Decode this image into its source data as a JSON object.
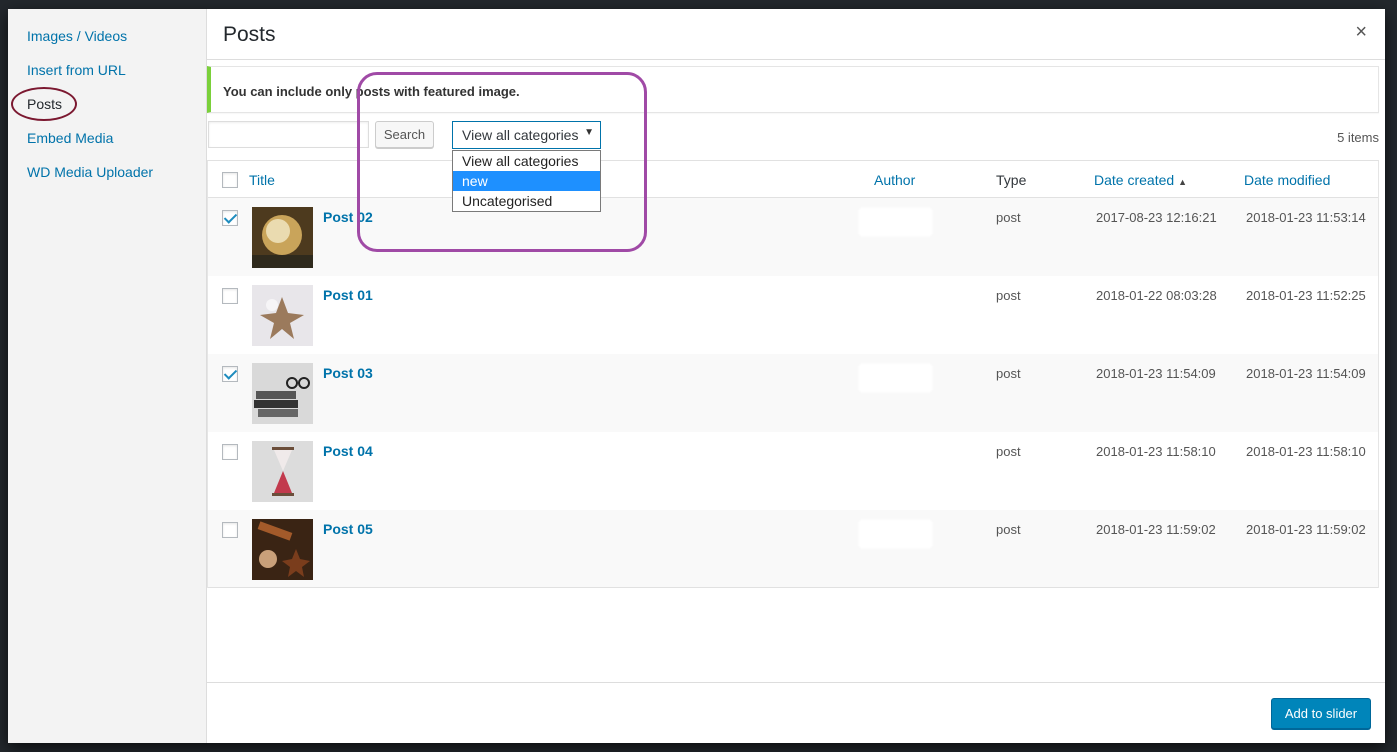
{
  "sidebar": {
    "items": [
      {
        "label": "Images / Videos"
      },
      {
        "label": "Insert from URL"
      },
      {
        "label": "Posts"
      },
      {
        "label": "Embed Media"
      },
      {
        "label": "WD Media Uploader"
      }
    ]
  },
  "header": {
    "title": "Posts",
    "close": "×"
  },
  "notice": {
    "text": "You can include only posts with featured image."
  },
  "toolbar": {
    "search_placeholder": "",
    "search_label": "Search",
    "category_selected": "View all categories",
    "category_options": [
      "View all categories",
      "new",
      "Uncategorised"
    ],
    "highlighted_option": "new",
    "items_count": "5 items"
  },
  "table": {
    "headers": {
      "title": "Title",
      "author": "Author",
      "type": "Type",
      "date_created": "Date created",
      "date_modified": "Date modified"
    },
    "sort_indicator": "▲",
    "rows": [
      {
        "title": "Post 02",
        "checked": true,
        "type": "post",
        "created": "2017-08-23 12:16:21",
        "modified": "2018-01-23 11:53:14"
      },
      {
        "title": "Post 01",
        "checked": false,
        "type": "post",
        "created": "2018-01-22 08:03:28",
        "modified": "2018-01-23 11:52:25"
      },
      {
        "title": "Post 03",
        "checked": true,
        "type": "post",
        "created": "2018-01-23 11:54:09",
        "modified": "2018-01-23 11:54:09"
      },
      {
        "title": "Post 04",
        "checked": false,
        "type": "post",
        "created": "2018-01-23 11:58:10",
        "modified": "2018-01-23 11:58:10"
      },
      {
        "title": "Post 05",
        "checked": false,
        "type": "post",
        "created": "2018-01-23 11:59:02",
        "modified": "2018-01-23 11:59:02"
      }
    ]
  },
  "footer": {
    "add_label": "Add to slider"
  },
  "colors": {
    "accent": "#0073aa",
    "button": "#0085ba",
    "notice_border": "#7ad03a",
    "highlight_circle": "#a04aa6"
  }
}
